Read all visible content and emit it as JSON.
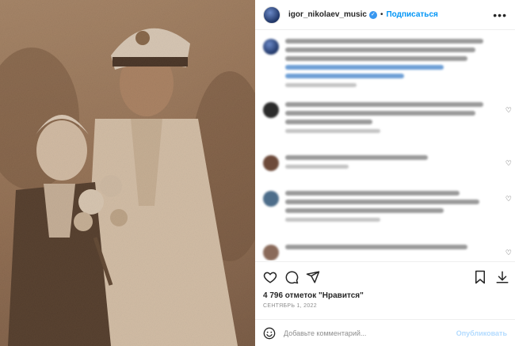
{
  "header": {
    "username": "igor_nikolaev_music",
    "separator": "•",
    "follow_label": "Подписаться",
    "more_icon": "more-horizontal-icon"
  },
  "actions": {
    "like_icon": "heart-outline-icon",
    "comment_icon": "comment-bubble-icon",
    "share_icon": "send-paper-plane-icon",
    "save_icon": "bookmark-icon",
    "download_icon": "download-icon"
  },
  "likes_text": "4 796 отметок \"Нравится\"",
  "date_text": "СЕНТЯБРЬ 1, 2022",
  "comment_box": {
    "placeholder": "Добавьте комментарий...",
    "publish_label": "Опубликовать"
  },
  "colors": {
    "accent": "#0095f6",
    "verified": "#3897f0",
    "publish_disabled": "#b3dbff"
  }
}
